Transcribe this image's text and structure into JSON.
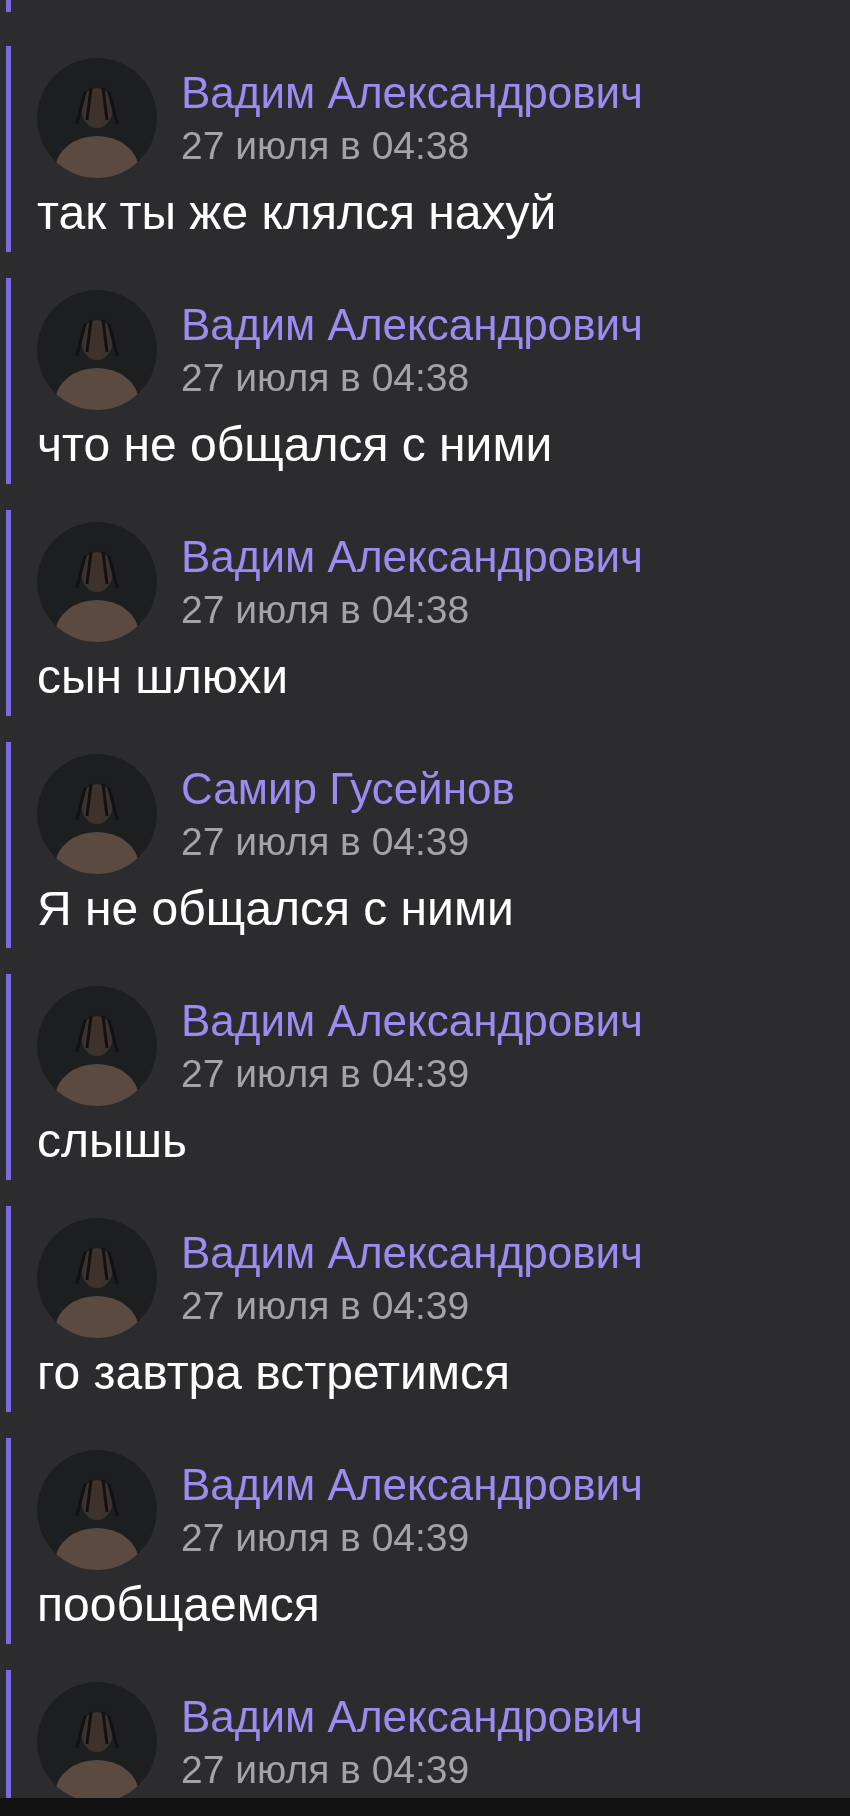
{
  "messages": [
    {
      "author": "Вадим Александрович",
      "time": "27 июля в 04:38",
      "text": "так ты же клялся нахуй"
    },
    {
      "author": "Вадим Александрович",
      "time": "27 июля в 04:38",
      "text": "что не общался с ними"
    },
    {
      "author": "Вадим Александрович",
      "time": "27 июля в 04:38",
      "text": "сын шлюхи"
    },
    {
      "author": "Самир Гусейнов",
      "time": "27 июля в 04:39",
      "text": "Я не общался с ними"
    },
    {
      "author": "Вадим Александрович",
      "time": "27 июля в 04:39",
      "text": "слышь"
    },
    {
      "author": "Вадим Александрович",
      "time": "27 июля в 04:39",
      "text": "го завтра встретимся"
    },
    {
      "author": "Вадим Александрович",
      "time": "27 июля в 04:39",
      "text": "пообщаемся"
    },
    {
      "author": "Вадим Александрович",
      "time": "27 июля в 04:39"
    }
  ]
}
